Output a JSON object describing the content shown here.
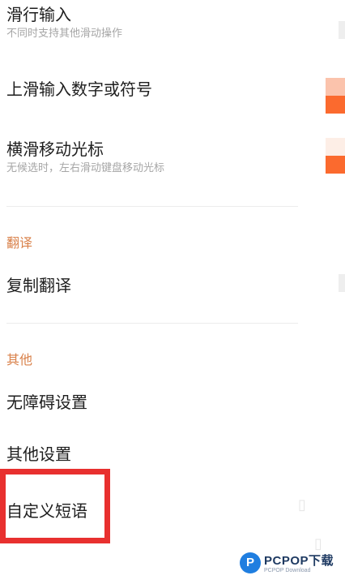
{
  "settings": {
    "slide_input": {
      "title": "滑行输入",
      "subtitle": "不同时支持其他滑动操作"
    },
    "swipe_up_input": {
      "title": "上滑输入数字或符号"
    },
    "horizontal_cursor": {
      "title": "横滑移动光标",
      "subtitle": "无候选时，左右滑动键盘移动光标"
    }
  },
  "sections": {
    "translate": {
      "header": "翻译",
      "items": [
        "复制翻译"
      ]
    },
    "other": {
      "header": "其他",
      "items": [
        "无障碍设置",
        "其他设置",
        "自定义短语"
      ]
    }
  },
  "highlight": {
    "color": "#e8302f",
    "target": "自定义短语"
  },
  "toggle_colors": {
    "on_track": "#fbc3ac",
    "on_thumb": "#fb6a2e",
    "off": "#eeeeee"
  },
  "accent_color": "#d9814a",
  "watermark": {
    "logo_letter": "P",
    "brand": "PCPOP",
    "brand_suffix": "下载",
    "tagline": "PCPOP Download"
  }
}
